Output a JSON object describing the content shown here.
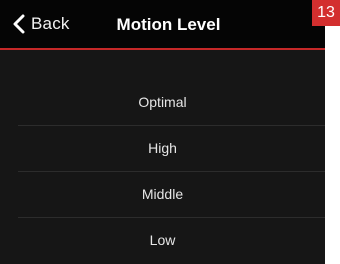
{
  "navbar": {
    "back_label": "Back",
    "title": "Motion Level"
  },
  "step_badge": "13",
  "options": [
    {
      "label": "Optimal"
    },
    {
      "label": "High"
    },
    {
      "label": "Middle"
    },
    {
      "label": "Low"
    }
  ],
  "colors": {
    "accent": "#c62828",
    "badge": "#d32f2f",
    "background": "#161616",
    "navbar": "#050505",
    "divider": "#2c2c2c"
  },
  "icons": {
    "back": "chevron-left-icon"
  }
}
